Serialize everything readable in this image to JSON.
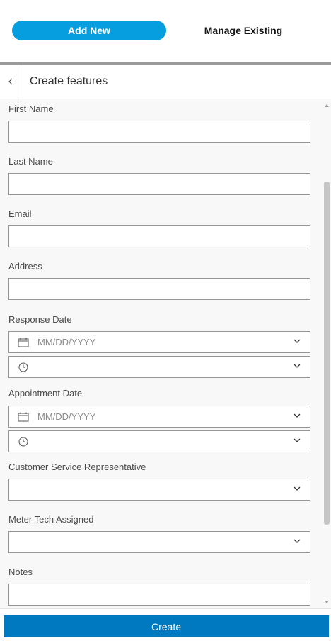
{
  "nav": {
    "add_new": "Add New",
    "manage_existing": "Manage Existing"
  },
  "header": {
    "title": "Create features"
  },
  "form": {
    "first_name": {
      "label": "First Name",
      "value": ""
    },
    "last_name": {
      "label": "Last Name",
      "value": ""
    },
    "email": {
      "label": "Email",
      "value": ""
    },
    "address": {
      "label": "Address",
      "value": ""
    },
    "response_date": {
      "label": "Response Date",
      "date_placeholder": "MM/DD/YYYY",
      "time_value": ""
    },
    "appointment_date": {
      "label": "Appointment Date",
      "date_placeholder": "MM/DD/YYYY",
      "time_value": ""
    },
    "csr": {
      "label": "Customer Service Representative",
      "value": ""
    },
    "meter_tech": {
      "label": "Meter Tech Assigned",
      "value": ""
    },
    "notes": {
      "label": "Notes",
      "value": ""
    }
  },
  "footer": {
    "create_label": "Create"
  },
  "colors": {
    "accent": "#079ee0",
    "primary_button": "#0079c1"
  },
  "icons": [
    "chevron-left-icon",
    "calendar-icon",
    "clock-icon",
    "chevron-down-icon",
    "scroll-up-arrow-icon",
    "scroll-down-arrow-icon"
  ]
}
